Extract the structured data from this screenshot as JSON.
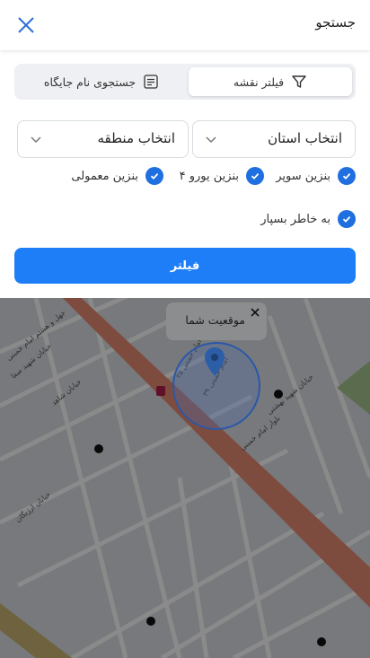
{
  "header": {
    "title": "جستجو"
  },
  "tabs": {
    "map_filter": "فیلتر نقشه",
    "name_search": "جستجوی نام جایگاه"
  },
  "filters": {
    "province": "انتخاب استان",
    "region": "انتخاب منطقه",
    "fuel_super": "بنزین سوپر",
    "fuel_euro4": "بنزین یورو ۴",
    "fuel_regular": "بنزین معمولی",
    "crowd": "به خاطر بسپار",
    "button": "فیلتر"
  },
  "map": {
    "popup": "موقعیت شما",
    "streets": [
      "بلوار امام خمینی",
      "خیابان ارژنگان",
      "خیابان شاهد",
      "امام خمینی ۲۵",
      "امام خمینی ۳۹",
      "خیابان شهید صفا",
      "خیابان شهید بهشتی",
      "جهل و هشتم امام خمینی"
    ]
  },
  "colors": {
    "accent": "#1e7ef7",
    "check": "#1f6fe0"
  }
}
